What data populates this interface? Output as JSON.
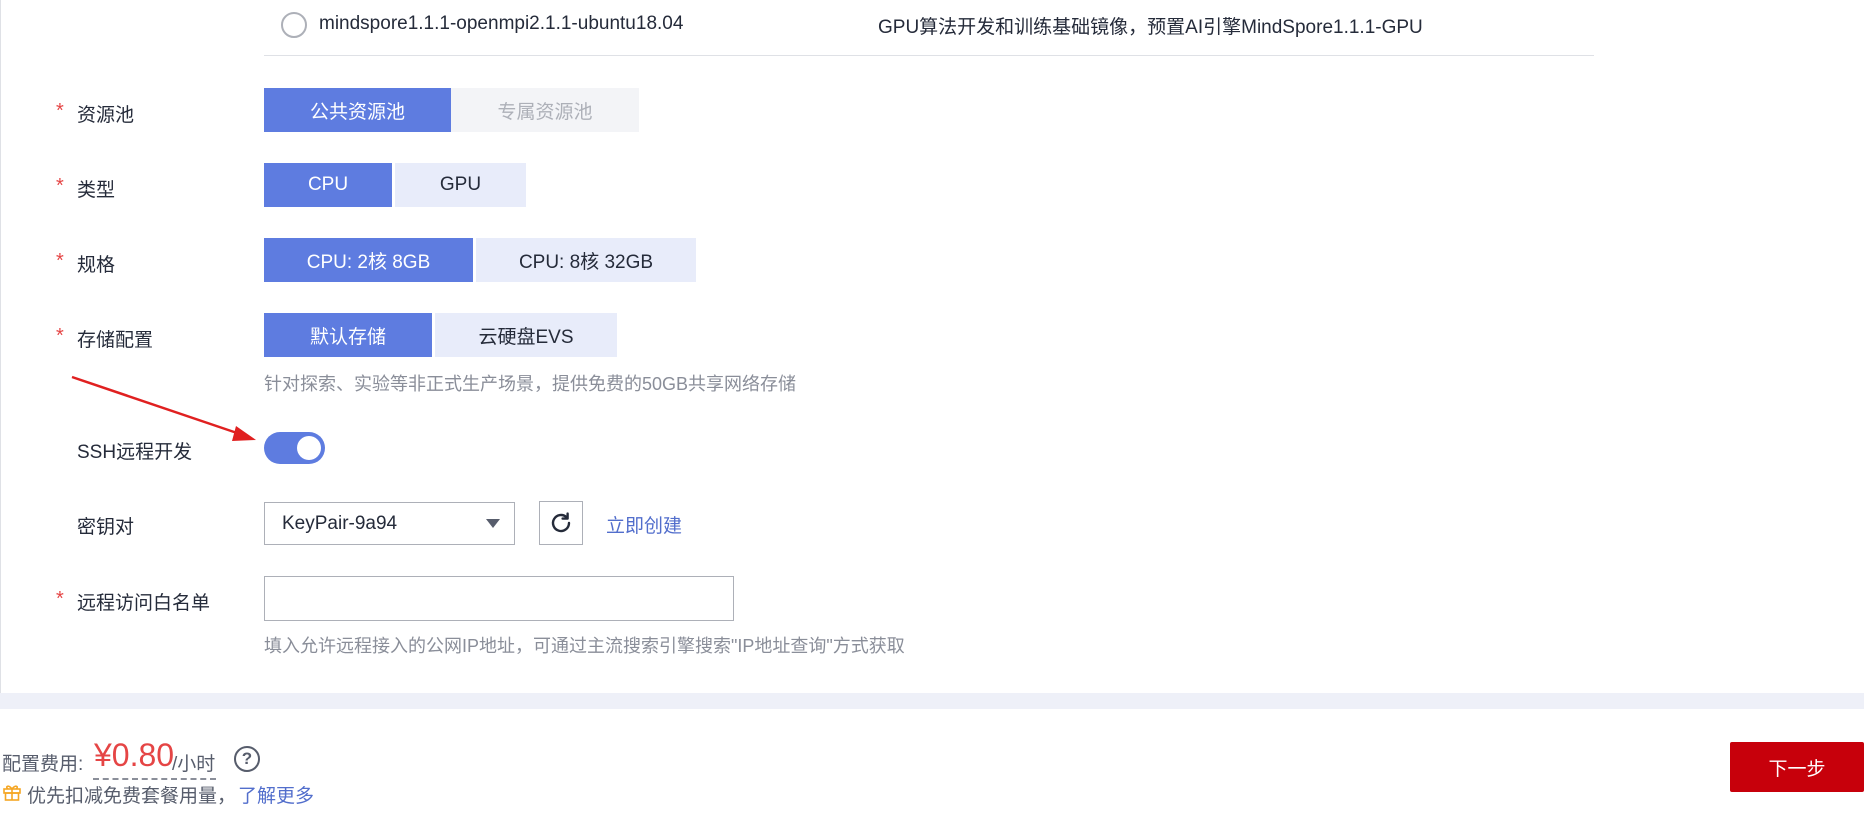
{
  "image": {
    "name": "mindspore1.1.1-openmpi2.1.1-ubuntu18.04",
    "desc": "GPU算法开发和训练基础镜像，预置AI引擎MindSpore1.1.1-GPU"
  },
  "form": {
    "required_mark": "*",
    "resource_pool": {
      "label": "资源池",
      "options": [
        "公共资源池",
        "专属资源池"
      ],
      "selected": "公共资源池"
    },
    "type": {
      "label": "类型",
      "options": [
        "CPU",
        "GPU"
      ],
      "selected": "CPU"
    },
    "spec": {
      "label": "规格",
      "options": [
        "CPU: 2核 8GB",
        "CPU: 8核 32GB"
      ],
      "selected": "CPU: 2核 8GB"
    },
    "storage": {
      "label": "存储配置",
      "options": [
        "默认存储",
        "云硬盘EVS"
      ],
      "selected": "默认存储",
      "hint": "针对探索、实验等非正式生产场景，提供免费的50GB共享网络存储"
    },
    "ssh": {
      "label": "SSH远程开发",
      "enabled": true
    },
    "keypair": {
      "label": "密钥对",
      "value": "KeyPair-9a94",
      "create_link": "立即创建"
    },
    "whitelist": {
      "label": "远程访问白名单",
      "value": "",
      "hint": "填入允许远程接入的公网IP地址，可通过主流搜索引擎搜索\"IP地址查询\"方式获取"
    }
  },
  "footer": {
    "fee_label": "配置费用:",
    "price": "¥0.80",
    "unit": "/小时",
    "help": "?",
    "promo_text": "优先扣减免费套餐用量，",
    "promo_link": "了解更多",
    "next_button": "下一步"
  },
  "colors": {
    "primary": "#5e7ce0",
    "segment_inactive": "#e8ecfa",
    "danger": "#c7000b",
    "price": "#e54545",
    "link": "#526ecc",
    "arrow": "#e02020"
  },
  "icons": {
    "refresh": "refresh-icon",
    "caret": "caret-down-icon",
    "gift": "gift-icon",
    "help": "question-circle-icon"
  }
}
